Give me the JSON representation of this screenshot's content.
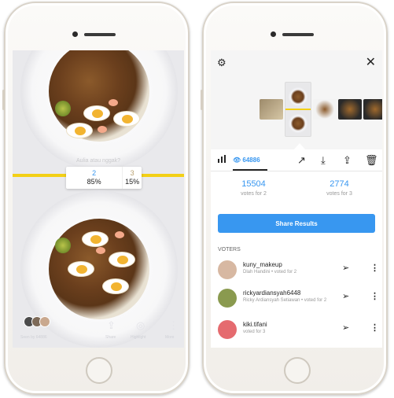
{
  "story": {
    "question": "Aulia atau nggak?",
    "poll": {
      "option_a": "2",
      "option_a_percent": "85%",
      "option_b": "3",
      "option_b_percent": "15%"
    },
    "bottom": {
      "seen_by": "Seen by 64886",
      "share_label": "Share",
      "highlight_label": "Highlight",
      "more_label": "More"
    }
  },
  "insights": {
    "viewers_count": "64886",
    "votes": [
      {
        "count": "15504",
        "label": "votes for 2"
      },
      {
        "count": "2774",
        "label": "votes for 3"
      }
    ],
    "share_button": "Share Results",
    "voters_heading": "VOTERS",
    "voters": [
      {
        "username": "kuny_makeup",
        "subtitle": "Dlah Handini • voted for 2",
        "avatar_color": "#d7b8a2"
      },
      {
        "username": "rickyardiansyah6448",
        "subtitle": "Ricky Ardiansyah Setiawan • voted for 2",
        "avatar_color": "#8a9a4f"
      },
      {
        "username": "kiki.tifani",
        "subtitle": "voted for 3",
        "avatar_color": "#e56b6f"
      }
    ]
  },
  "icons": {
    "settings": "gear-icon",
    "close": "close-icon",
    "chart": "bar-chart-icon",
    "trend": "trend-icon",
    "download": "download-icon",
    "share": "share-icon",
    "delete": "trash-icon",
    "send": "send-icon",
    "more": "more-icon"
  },
  "colors": {
    "accent": "#3897f0",
    "poll_bar": "#f3d016"
  }
}
